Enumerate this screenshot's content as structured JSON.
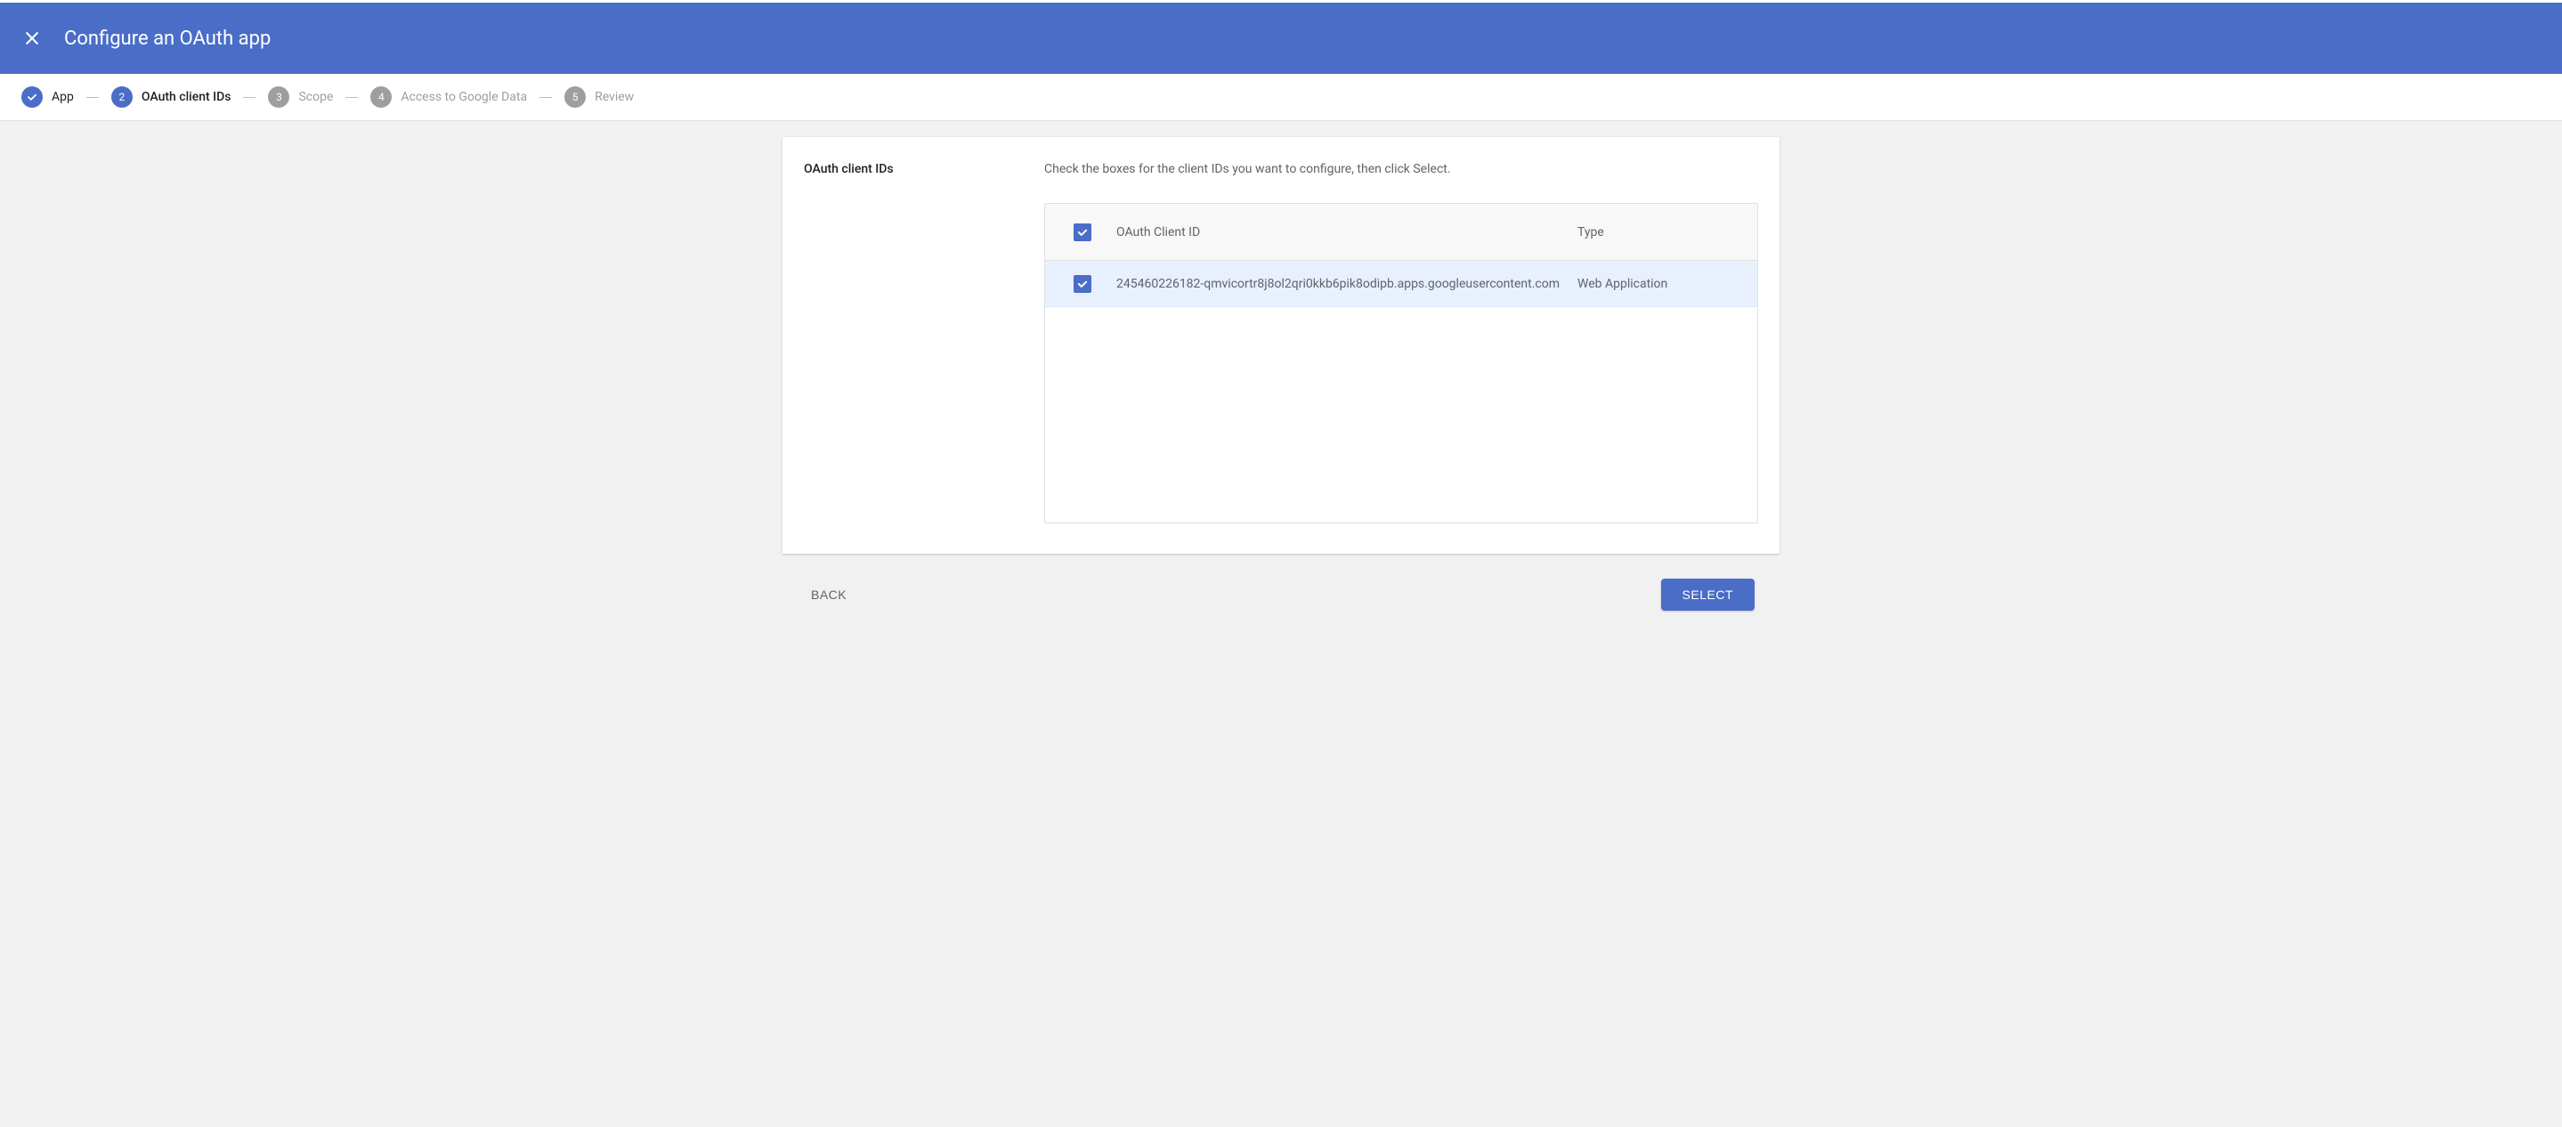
{
  "header": {
    "title": "Configure an OAuth app"
  },
  "stepper": {
    "steps": [
      {
        "num": "check",
        "label": "App",
        "state": "done"
      },
      {
        "num": "2",
        "label": "OAuth client IDs",
        "state": "active"
      },
      {
        "num": "3",
        "label": "Scope",
        "state": "inactive"
      },
      {
        "num": "4",
        "label": "Access to Google Data",
        "state": "inactive"
      },
      {
        "num": "5",
        "label": "Review",
        "state": "inactive"
      }
    ]
  },
  "panel": {
    "title": "OAuth client IDs",
    "instructions": "Check the boxes for the client IDs you want to configure, then click Select."
  },
  "table": {
    "headers": {
      "id": "OAuth Client ID",
      "type": "Type"
    },
    "rows": [
      {
        "id": "245460226182-qmvicortr8j8ol2qri0kkb6pik8odipb.apps.googleusercontent.com",
        "type": "Web Application",
        "checked": true
      }
    ]
  },
  "actions": {
    "back": "Back",
    "select": "Select"
  }
}
